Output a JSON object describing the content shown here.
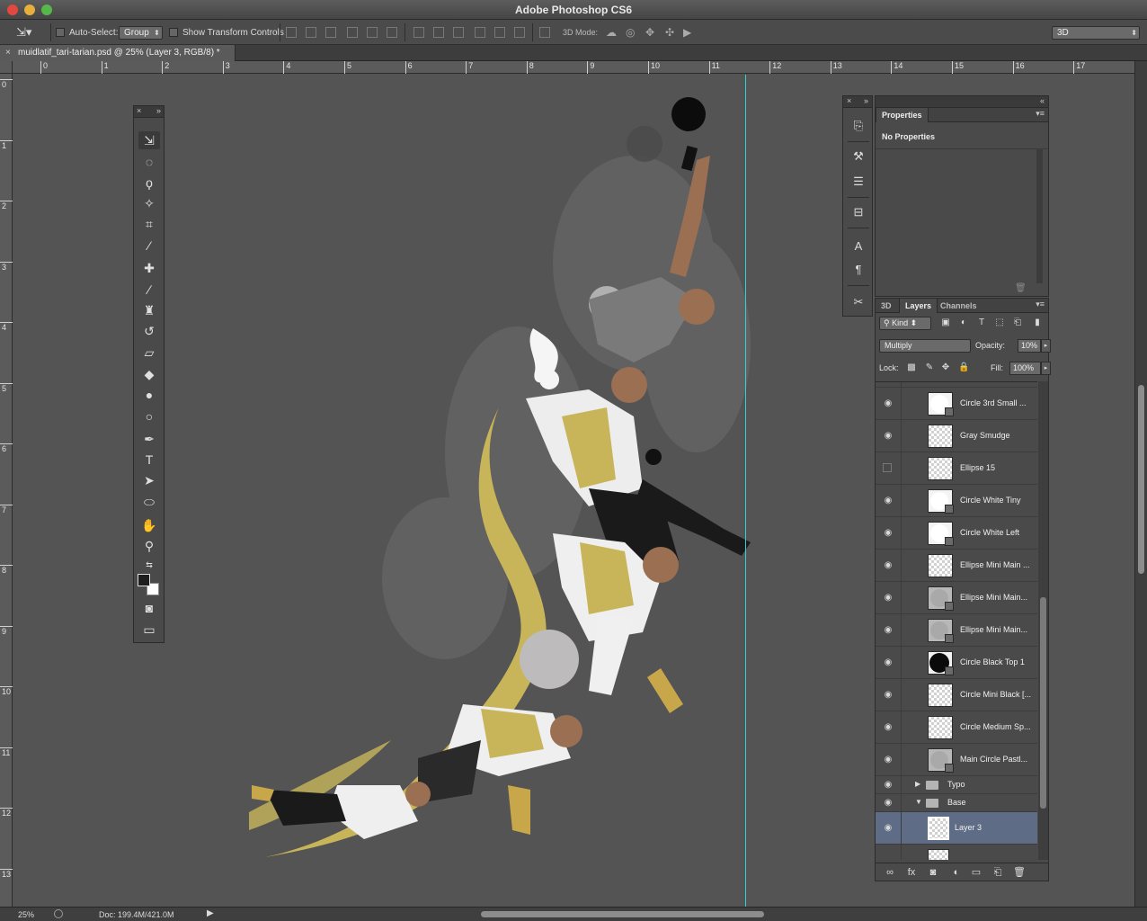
{
  "window": {
    "title": "Adobe Photoshop CS6"
  },
  "options_bar": {
    "auto_select_label": "Auto-Select:",
    "auto_select_value": "Group",
    "show_transform_label": "Show Transform Controls",
    "mode_3d_label": "3D Mode:",
    "workspace_value": "3D"
  },
  "document": {
    "tab_title": "muidlatif_tari-tarian.psd @ 25% (Layer 3, RGB/8) *"
  },
  "rulers": {
    "horizontal": [
      "0",
      "1",
      "2",
      "3",
      "4",
      "5",
      "6",
      "7",
      "8",
      "9",
      "10",
      "11",
      "12",
      "13",
      "14",
      "15",
      "16",
      "17"
    ],
    "vertical": [
      "0",
      "1",
      "2",
      "3",
      "4",
      "5",
      "6",
      "7",
      "8",
      "9",
      "10",
      "11",
      "12",
      "13"
    ]
  },
  "properties_panel": {
    "tab": "Properties",
    "message": "No Properties"
  },
  "layers_panel": {
    "tabs": [
      "3D",
      "Layers",
      "Channels"
    ],
    "active_tab": "Layers",
    "filter_kind": "Kind",
    "blend_mode": "Multiply",
    "opacity_label": "Opacity:",
    "opacity_value": "10%",
    "lock_label": "Lock:",
    "fill_label": "Fill:",
    "fill_value": "100%",
    "layers": [
      {
        "name": "Circle 3rd Small ...",
        "visible": true,
        "thumb": "white"
      },
      {
        "name": "Gray Smudge",
        "visible": true,
        "thumb": "checker"
      },
      {
        "name": "Ellipse 15",
        "visible": false,
        "thumb": "checker"
      },
      {
        "name": "Circle White Tiny",
        "visible": true,
        "thumb": "white"
      },
      {
        "name": "Circle White Left",
        "visible": true,
        "thumb": "white"
      },
      {
        "name": "Ellipse Mini Main ...",
        "visible": true,
        "thumb": "checker"
      },
      {
        "name": "Ellipse Mini Main...",
        "visible": true,
        "thumb": "gray"
      },
      {
        "name": "Ellipse Mini Main...",
        "visible": true,
        "thumb": "gray"
      },
      {
        "name": "Circle Black Top 1",
        "visible": true,
        "thumb": "black"
      },
      {
        "name": "Circle Mini Black [...",
        "visible": true,
        "thumb": "checker"
      },
      {
        "name": "Circle Medium Sp...",
        "visible": true,
        "thumb": "checker"
      },
      {
        "name": "Main Circle Pastl...",
        "visible": true,
        "thumb": "gray"
      }
    ],
    "groups": [
      {
        "name": "Typo",
        "expanded": false
      },
      {
        "name": "Base",
        "expanded": true
      }
    ],
    "selected_layer": "Layer 3"
  },
  "status_bar": {
    "zoom": "25%",
    "doc_size": "Doc: 199.4M/421.0M"
  },
  "colors": {
    "accent_yellow": "#c8b55a",
    "guide": "#2fd3d8",
    "selected_row": "#5e6c86",
    "canvas_bg": "#545454"
  }
}
